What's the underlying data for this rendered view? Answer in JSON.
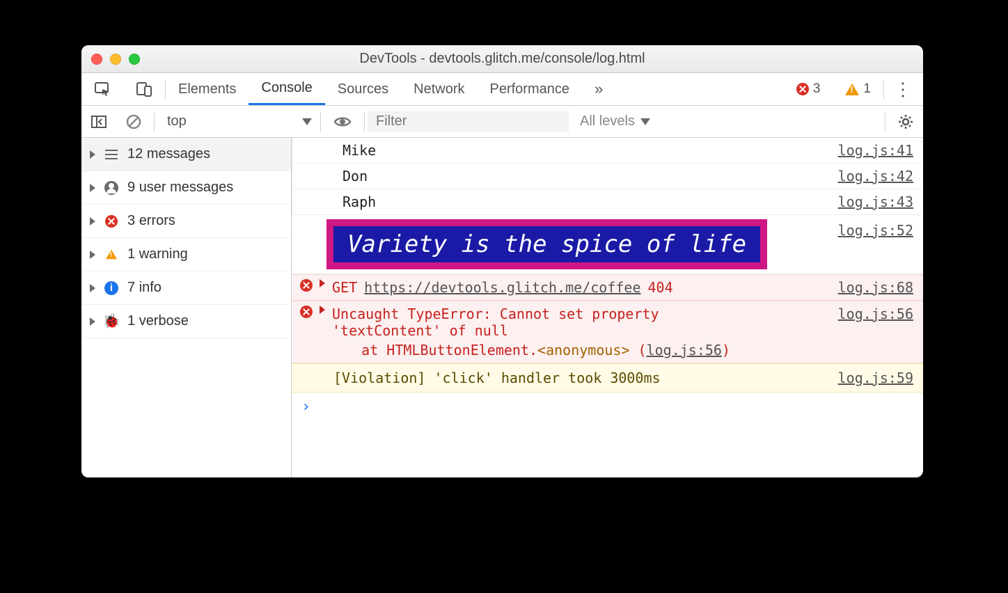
{
  "window": {
    "title": "DevTools - devtools.glitch.me/console/log.html"
  },
  "tabs": {
    "elements": "Elements",
    "console": "Console",
    "sources": "Sources",
    "network": "Network",
    "performance": "Performance",
    "overflow": "»"
  },
  "counters": {
    "errors": "3",
    "warnings": "1"
  },
  "toolbar": {
    "context": "top",
    "filter_placeholder": "Filter",
    "levels": "All levels"
  },
  "sidebar": {
    "messages": {
      "count": "12",
      "label": "messages"
    },
    "user": {
      "count": "9",
      "label": "user messages"
    },
    "errors": {
      "count": "3",
      "label": "errors"
    },
    "warnings": {
      "count": "1",
      "label": "warning"
    },
    "info": {
      "count": "7",
      "label": "info"
    },
    "verbose": {
      "count": "1",
      "label": "verbose"
    }
  },
  "logs": {
    "items": [
      {
        "text": "Mike",
        "src": "log.js:41"
      },
      {
        "text": "Don",
        "src": "log.js:42"
      },
      {
        "text": "Raph",
        "src": "log.js:43"
      }
    ],
    "styled": {
      "text": "Variety is the spice of life",
      "src": "log.js:52"
    },
    "netError": {
      "method": "GET",
      "url": "https://devtools.glitch.me/coffee",
      "status": "404",
      "src": "log.js:68"
    },
    "typeError": {
      "line1": "Uncaught TypeError: Cannot set property",
      "line2": "'textContent' of null",
      "stackPrefix": "at HTMLButtonElement.",
      "stackFn": "<anonymous>",
      "stackLoc": "log.js:56",
      "src": "log.js:56"
    },
    "violation": {
      "text": "[Violation] 'click' handler took 3000ms",
      "src": "log.js:59"
    },
    "prompt": "›"
  }
}
